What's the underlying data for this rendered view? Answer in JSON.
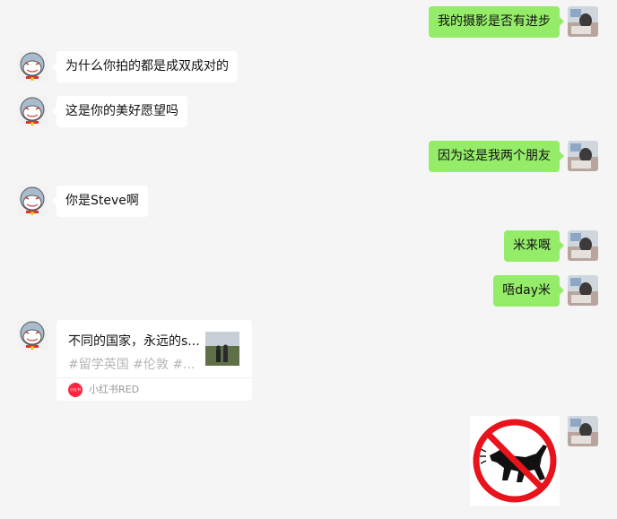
{
  "messages": [
    {
      "side": "right",
      "text": "我的摄影是否有进步"
    },
    {
      "side": "left",
      "text": "为什么你拍的都是成双成对的"
    },
    {
      "side": "left",
      "text": "这是你的美好愿望吗"
    },
    {
      "side": "right",
      "text": "因为这是我两个朋友"
    },
    {
      "side": "left",
      "text": "你是Steve啊"
    },
    {
      "side": "right",
      "text": "米来嘅"
    },
    {
      "side": "right",
      "text": "唔day米"
    }
  ],
  "shared_card": {
    "title": "不同的国家，永远的s...",
    "tags": "#留学英国  #伦敦  #...",
    "source_logo_text": "小红书",
    "source": "小红书RED"
  },
  "sticker": {
    "icon": "no-dog-sign-icon"
  },
  "colors": {
    "background": "#f5f5f5",
    "sent_bubble": "#95ec69",
    "received_bubble": "#ffffff",
    "prohibition_red": "#e8131b"
  }
}
